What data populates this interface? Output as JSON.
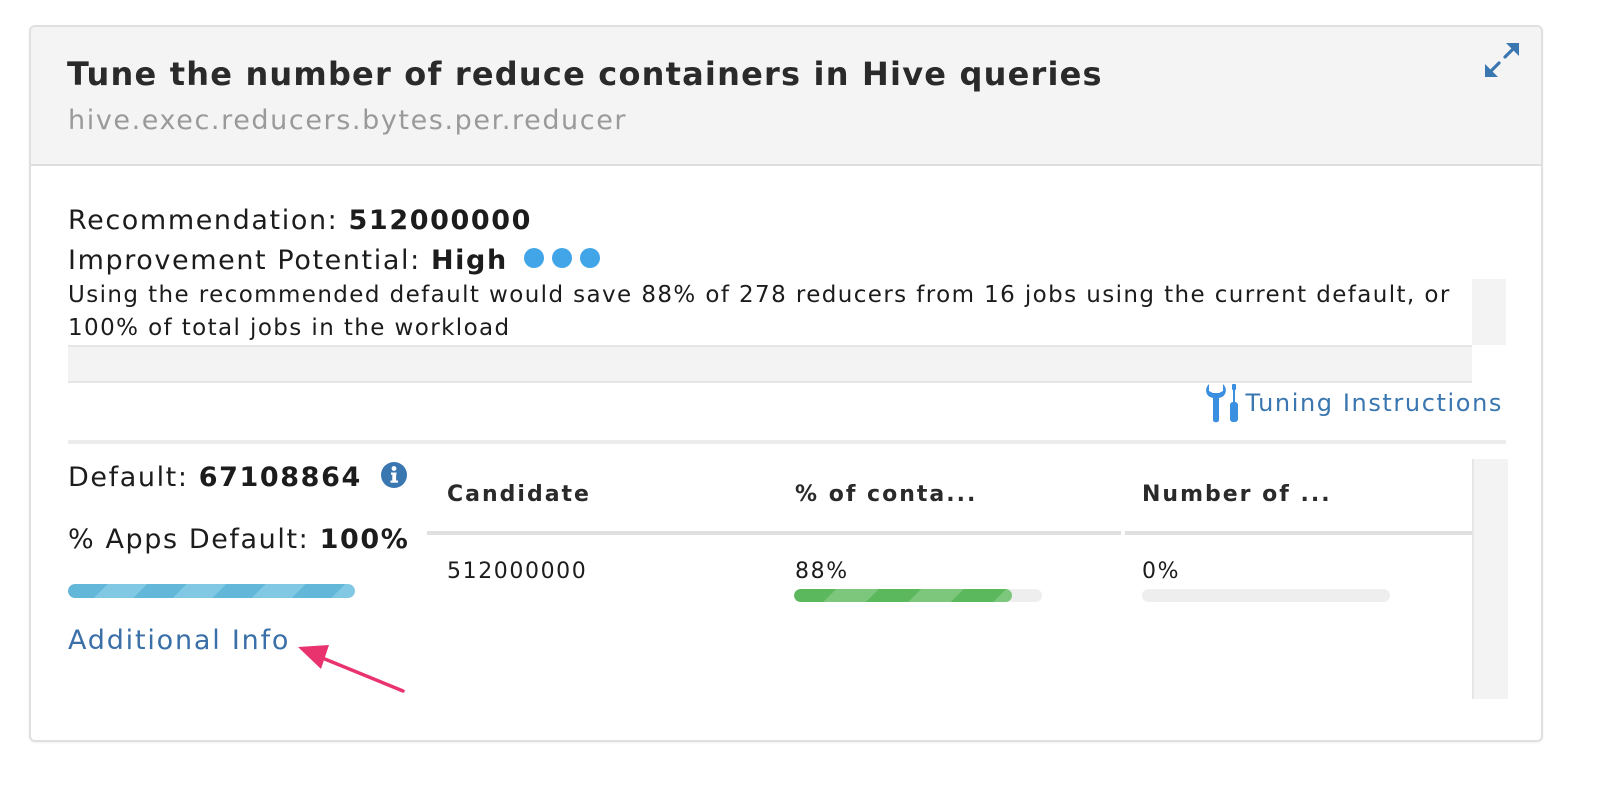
{
  "header": {
    "title": "Tune the number of reduce containers in Hive queries",
    "subtitle": "hive.exec.reducers.bytes.per.reducer",
    "expand_icon": "expand-icon"
  },
  "recommendation": {
    "label": "Recommendation:",
    "value": "512000000"
  },
  "improvement": {
    "label": "Improvement Potential:",
    "value": "High",
    "dots": 3,
    "dot_color": "#42a5e8"
  },
  "description": "Using the recommended default would save 88% of 278 reducers from 16 jobs using the current default, or 100% of total jobs in the workload",
  "tuning_instructions": {
    "label": "Tuning Instructions",
    "icon": "tools-icon",
    "color": "#3a76b0"
  },
  "defaults": {
    "default_label": "Default:",
    "default_value": "67108864",
    "info_icon": "info-icon",
    "apps_label": "% Apps Default:",
    "apps_value": "100%",
    "apps_fraction": 1.0,
    "additional_info_label": "Additional Info"
  },
  "table": {
    "columns": [
      "Candidate",
      "% of conta...",
      "Number of ..."
    ],
    "rows": [
      {
        "candidate": "512000000",
        "pct_containers": "88%",
        "pct_containers_fraction": 0.88,
        "number_of": "0%",
        "number_of_fraction": 0.0
      }
    ]
  },
  "colors": {
    "accent_link": "#3a6fa8",
    "progress_blue": "#63b7d8",
    "progress_green": "#5cb85c",
    "arrow": "#e8336e"
  }
}
